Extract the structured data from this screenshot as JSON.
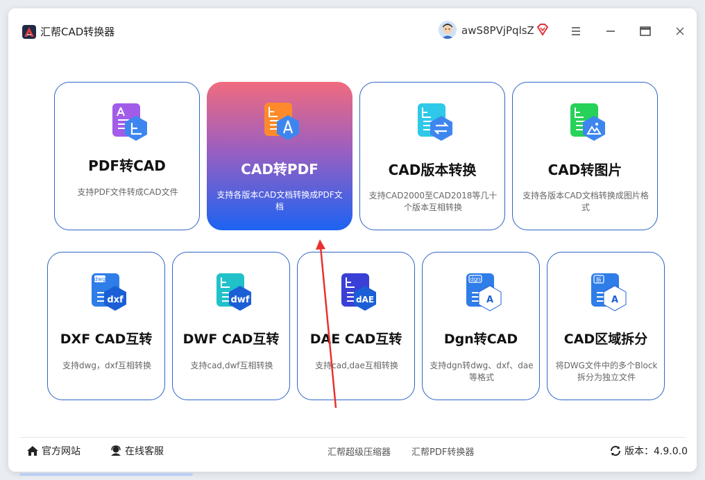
{
  "app": {
    "title": "汇帮CAD转换器"
  },
  "user": {
    "name": "awS8PVjPqlsZ"
  },
  "colors": {
    "accent": "#2d64c8",
    "active_top": "#f06b7e",
    "active_bottom": "#1c63f2",
    "vip": "#e0313a"
  },
  "cards": [
    {
      "title": "PDF转CAD",
      "desc": "支持PDF文件转成CAD文件",
      "icon": "pdf-to-cad-icon",
      "icon_text": ""
    },
    {
      "title": "CAD转PDF",
      "desc": "支持各版本CAD文档转换成PDF文档",
      "icon": "cad-to-pdf-icon",
      "icon_text": ""
    },
    {
      "title": "CAD版本转换",
      "desc": "支持CAD2000至CAD2018等几十个版本互相转换",
      "icon": "cad-version-icon",
      "icon_text": ""
    },
    {
      "title": "CAD转图片",
      "desc": "支持各版本CAD文档转换成图片格式",
      "icon": "cad-to-image-icon",
      "icon_text": ""
    },
    {
      "title": "DXF CAD互转",
      "desc": "支持dwg，dxf互相转换",
      "icon": "dxf-icon",
      "icon_text": "dxf",
      "tag_text": "dwg"
    },
    {
      "title": "DWF CAD互转",
      "desc": "支持cad,dwf互相转换",
      "icon": "dwf-icon",
      "icon_text": "dwf"
    },
    {
      "title": "DAE CAD互转",
      "desc": "支持cad,dae互相转换",
      "icon": "dae-icon",
      "icon_text": "dAE"
    },
    {
      "title": "Dgn转CAD",
      "desc": "支持dgn转dwg、dxf、dae等格式",
      "icon": "dgn-icon",
      "icon_text": "A",
      "tag_text": "dgn"
    },
    {
      "title": "CAD区域拆分",
      "desc": "将DWG文件中的多个Block拆分为独立文件",
      "icon": "split-icon",
      "icon_text": "A",
      "tag_text": "拆"
    }
  ],
  "footer": {
    "website": "官方网站",
    "support": "在线客服",
    "link1": "汇帮超级压缩器",
    "link2": "汇帮PDF转换器",
    "version_label": "版本：4.9.0.0"
  }
}
